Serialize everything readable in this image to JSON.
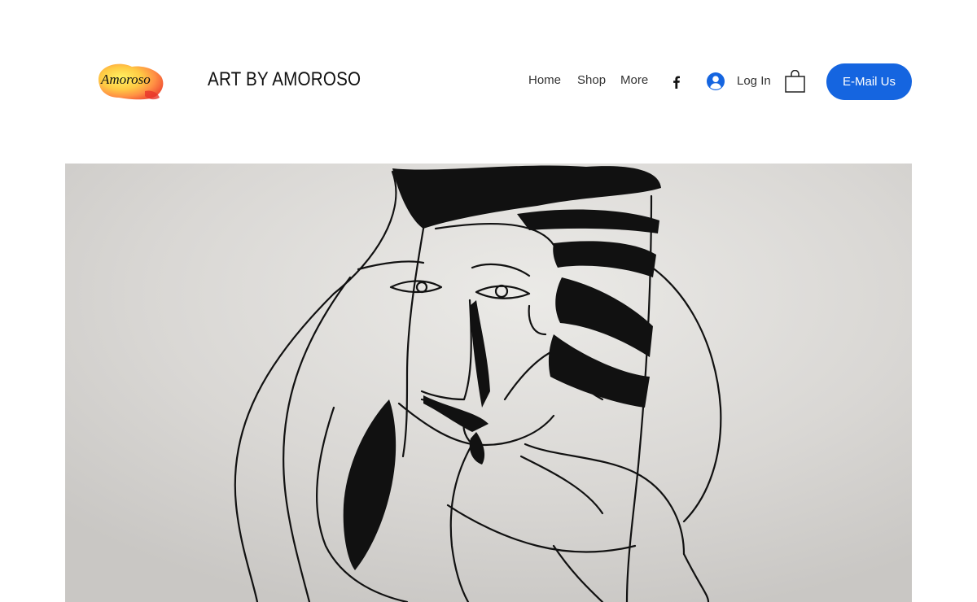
{
  "logo": {
    "text": "Amoroso",
    "icon": "watercolor-logo"
  },
  "site": {
    "title": "ART BY AMOROSO"
  },
  "nav": {
    "items": [
      "Home",
      "Shop",
      "More"
    ]
  },
  "social": {
    "icon": "facebook-icon"
  },
  "account": {
    "login_label": "Log In",
    "icon": "user-avatar-icon"
  },
  "cart": {
    "icon": "shopping-bag-icon"
  },
  "cta": {
    "label": "E-Mail Us",
    "color": "#1565e0"
  },
  "hero": {
    "image": "line-drawing-artwork",
    "background": "#d4d2cf"
  }
}
